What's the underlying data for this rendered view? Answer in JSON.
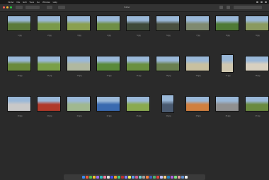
{
  "menubar": {
    "apple": "",
    "items": [
      "Finder",
      "File",
      "Edit",
      "View",
      "Go",
      "Window",
      "Help"
    ]
  },
  "window": {
    "title": "Folder"
  },
  "photos": [
    {
      "caption": "1.jpg",
      "c": "#5b7a3a"
    },
    {
      "caption": "2.jpg",
      "c": "#7a9a4a"
    },
    {
      "caption": "3.jpg",
      "c": "#8aa050"
    },
    {
      "caption": "4.jpg",
      "c": "#6f8f45"
    },
    {
      "caption": "5.jpg",
      "c": "#3f4a3a"
    },
    {
      "caption": "6.jpg",
      "c": "#4a5040"
    },
    {
      "caption": "7.jpg",
      "c": "#7f8a70"
    },
    {
      "caption": "8.jpg",
      "c": "#4f7a35"
    },
    {
      "caption": "9.jpg",
      "c": "#8a9a60"
    },
    {
      "caption": "10.jpg",
      "c": "#6a8a3c"
    },
    {
      "caption": "11.jpg",
      "c": "#7aa048"
    },
    {
      "caption": "12.jpg",
      "c": "#b0b8a0"
    },
    {
      "caption": "13.jpg",
      "c": "#5a8a3a"
    },
    {
      "caption": "14.jpg",
      "c": "#6a9040"
    },
    {
      "caption": "15.jpg",
      "c": "#6a8050"
    },
    {
      "caption": "16.jpg",
      "c": "#c8c0a0"
    },
    {
      "caption": "17.jpg",
      "c": "#d0c8b0"
    },
    {
      "caption": "18.jpg",
      "c": "#d8d0c0"
    },
    {
      "caption": "19.jpg",
      "c": "#c8c8c8"
    },
    {
      "caption": "20.jpg",
      "c": "#b03a2a"
    },
    {
      "caption": "21.jpg",
      "c": "#a0b890"
    },
    {
      "caption": "22.jpg",
      "c": "#3a6ab0"
    },
    {
      "caption": "23.jpg",
      "c": "#8aaa50"
    },
    {
      "caption": "24.jpg",
      "c": "#4a5a70"
    },
    {
      "caption": "25.jpg",
      "c": "#d08040"
    },
    {
      "caption": "26.jpg",
      "c": "#909090"
    },
    {
      "caption": "27.jpg",
      "c": "#6a8a40"
    }
  ],
  "dock_colors": [
    "#3a8af0",
    "#f05a3a",
    "#50c050",
    "#f0c030",
    "#9a6af0",
    "#30c0c0",
    "#f080a0",
    "#e0e0e0",
    "#4a4af0",
    "#f0a030",
    "#3ad080",
    "#c03030",
    "#8080ff",
    "#f0f060",
    "#60a0f0",
    "#d06090",
    "#70d0d0",
    "#a0a0a0",
    "#ff8040",
    "#4060c0",
    "#50b070",
    "#e04040",
    "#c0c0ff",
    "#ffd080",
    "#2080c0",
    "#b060e0",
    "#80e080",
    "#e0a0a0",
    "#6090d0",
    "#f0f0f0"
  ]
}
